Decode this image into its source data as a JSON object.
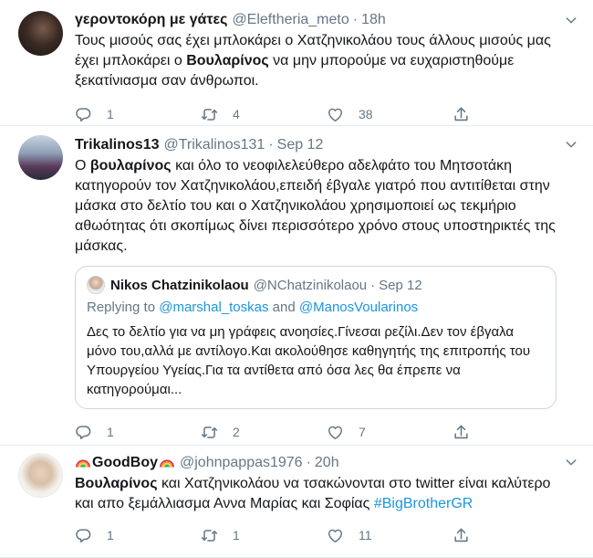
{
  "tweets": [
    {
      "name": "γεροντοκόρη με γάτες",
      "handle": "@Eleftheria_meto",
      "separator": "·",
      "time": "18h",
      "text_parts": [
        {
          "t": "Τους μισούς σας έχει μπλοκάρει ο Χατζηνικολάου τους άλλους μισούς μας έχει μπλοκάρει ο ",
          "b": false
        },
        {
          "t": "Βουλαρίνος",
          "b": true
        },
        {
          "t": " να μην μπορούμε να ευχαριστηθούμε ξεκατίνιασμα σαν άνθρωποι.",
          "b": false
        }
      ],
      "replies": "1",
      "retweets": "4",
      "likes": "38"
    },
    {
      "name": "Trikalinos13",
      "handle": "@Trikalinos131",
      "separator": "·",
      "time": "Sep 12",
      "text_parts": [
        {
          "t": "Ο ",
          "b": false
        },
        {
          "t": "βουλαρίνος",
          "b": true
        },
        {
          "t": " και όλο το νεοφιλελεύθερο αδελφάτο του Μητσοτάκη κατηγορούν τον Χατζηνικολάου,επειδή έβγαλε γιατρό που αντιτίθεται στην μάσκα στο δελτίο του και ο Χατζηνικολάου χρησιμοποιεί ως τεκμήριο αθωότητας ότι σκοπίμως δίνει περισσότερο χρόνο στους υποστηρικτές της μάσκας.",
          "b": false
        }
      ],
      "quote": {
        "name": "Nikos Chatzinikolaou",
        "handle": "@NChatzinikolaou",
        "separator": "·",
        "time": "Sep 12",
        "replying_prefix": "Replying to ",
        "replying_user1": "@marshal_toskas",
        "replying_and": " and ",
        "replying_user2": "@ManosVoularinos",
        "text": "Δες το δελτίο για να μη γράφεις ανοησίες.Γίνεσαι ρεζίλι.Δεν τον έβγαλα μόνο του,αλλά με αντίλογο.Και ακολούθησε καθηγητής της επιτροπής του Υπουργείου Υγείας.Για τα αντίθετα από όσα λες θα έπρεπε να κατηγορούμαι..."
      },
      "replies": "1",
      "retweets": "2",
      "likes": "7"
    },
    {
      "name": "GoodBoy",
      "handle": "@johnpappas1976",
      "separator": "·",
      "time": "20h",
      "text_parts": [
        {
          "t": "Βουλαρίνος",
          "b": true
        },
        {
          "t": " και Χατζηνικολάου να τσακώνονται στο twitter είναι καλύτερο και απο ξεμάλλιασμα Αννα Μαρίας και Σοφίας ",
          "b": false
        }
      ],
      "hashtag": "#BigBrotherGR",
      "replies": "1",
      "retweets": "1",
      "likes": "11"
    }
  ],
  "icons": [
    "reply-icon",
    "retweet-icon",
    "like-icon",
    "share-icon",
    "chevron-down-icon",
    "rainbow-icon"
  ],
  "colors": {
    "muted": "#657786",
    "link": "#1b95e0",
    "border": "#e6ecf0"
  }
}
